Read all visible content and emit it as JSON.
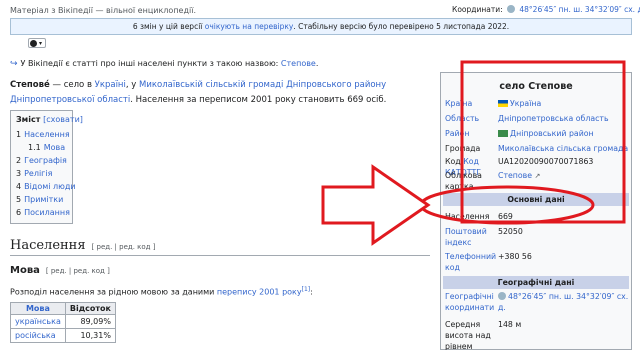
{
  "page": {
    "from_text": "Матеріал з Вікіпедії — вільної енциклопедії.",
    "coords_label": "Координати:",
    "coords_value": "48°26′45″ пн. ш. 34°32′09″ сх. д.",
    "flagged_pre": "6 змін у цій версії ",
    "flagged_link": "очікують на перевірку",
    "flagged_post": ". Стабільну версію було перевірено 5 листопада 2022.",
    "hatnote_pre": "У Вікіпедії є статті про інші населені пункти з такою назвою: ",
    "hatnote_link": "Степове",
    "hatnote_post": "."
  },
  "lead": {
    "name": "Степове́",
    "t1": " — село в ",
    "l1": "Україні",
    "t2": ", у ",
    "l2": "Миколаївській сільській громаді",
    "t3": " ",
    "l3": "Дніпровського району",
    "t4": " ",
    "l4": "Дніпропетровської області",
    "t5": ". Населення за переписом 2001 року становить 669 осіб."
  },
  "toc": {
    "title": "Зміст",
    "hide": "[сховати]",
    "items": [
      {
        "num": "1",
        "label": "Населення"
      },
      {
        "num": "1.1",
        "label": "Мова"
      },
      {
        "num": "2",
        "label": "Географія"
      },
      {
        "num": "3",
        "label": "Релігія"
      },
      {
        "num": "4",
        "label": "Відомі люди"
      },
      {
        "num": "5",
        "label": "Примітки"
      },
      {
        "num": "6",
        "label": "Посилання"
      }
    ]
  },
  "sections": {
    "population_heading": "Населення",
    "edit_label": "[ ред. | ред. код ]",
    "language_heading": "Мова",
    "distribution_pre": "Розподіл населення за рідною мовою за даними ",
    "distribution_link": "перепису 2001 року",
    "distribution_ref": "[1]",
    "distribution_post": ":"
  },
  "lang_table": {
    "headers": [
      "Мова",
      "Відсоток"
    ],
    "rows": [
      {
        "lang": "українська",
        "pct": "89,09%"
      },
      {
        "lang": "російська",
        "pct": "10,31%"
      }
    ]
  },
  "infobox": {
    "title": "село Степове",
    "country_k": "Країна",
    "country_v": "Україна",
    "oblast_k": "Область",
    "oblast_v": "Дніпропетровська область",
    "raion_k": "Район",
    "raion_v": "Дніпровський район",
    "hromada_k": "Громада",
    "hromada_v": "Миколаївська сільська громада",
    "katottg_k": "Код КАТОТТГ",
    "katottg_v": "UA12020090070071863",
    "card_k": "Облікова картка",
    "card_v": "Степове",
    "basic_head": "Основні дані",
    "population_k": "Населення",
    "population_v": "669",
    "postcode_k": "Поштовий індекс",
    "postcode_v": "52050",
    "phone_k": "Телефонний код",
    "phone_v": "+380 56",
    "geo_head": "Географічні дані",
    "geocoords_k": "Географічні координати",
    "geocoords_v": "48°26′45″ пн. ш. 34°32′09″ сх. д.",
    "elevation_k": "Середня висота над рівнем",
    "elevation_v": "148 м"
  },
  "colors": {
    "annotation": "#e0191f",
    "link": "#3366cc",
    "infobox_header": "#c8d1e8"
  }
}
